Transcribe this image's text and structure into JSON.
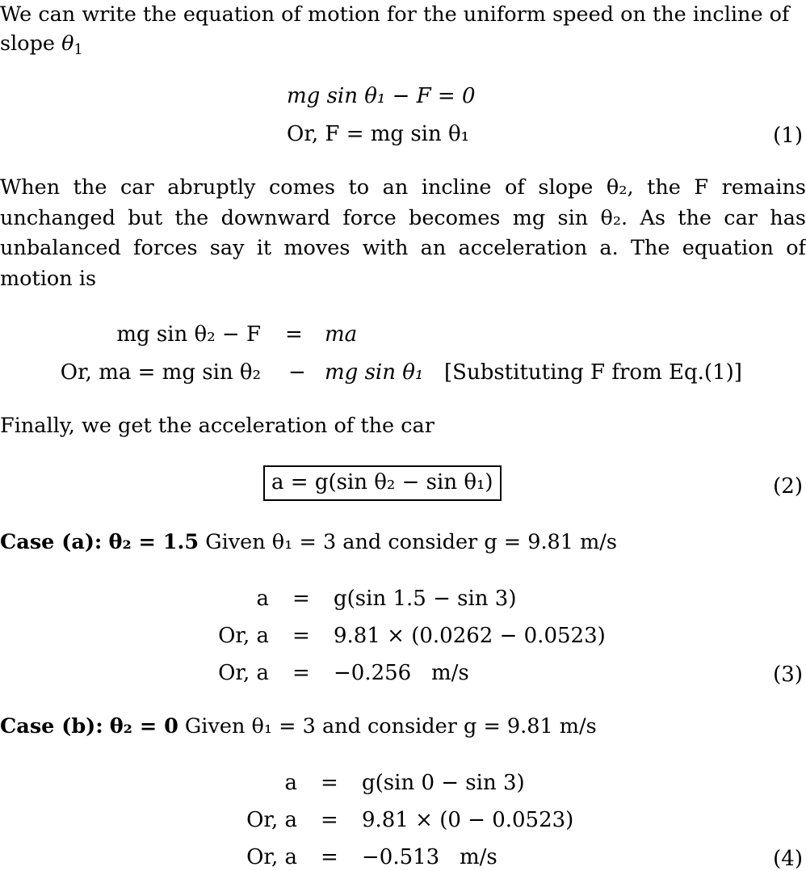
{
  "intro": {
    "line1": "We can write the equation of motion for the uniform speed on the incline of",
    "line2_text": "slope ",
    "line2_var": "θ",
    "line2_sub": "1"
  },
  "eq1": {
    "row1": "mg sin θ₁ − F = 0",
    "row2": "Or, F = mg sin θ₁",
    "number": "(1)"
  },
  "para2": {
    "text": "When the car abruptly comes to an incline of slope θ₂, the F remains unchanged but the downward force becomes mg sin θ₂. As the car has unbalanced forces say it moves with an acceleration a. The equation of motion is"
  },
  "eq_motion": {
    "row1_lhs": "mg sin θ₂ − F",
    "row1_rel": "=",
    "row1_rhs": "ma",
    "row2_lhs": "Or, ma = mg sin θ₂",
    "row2_rel": "−",
    "row2_rhs": "mg sin θ₁",
    "row2_note": "[Substituting F from Eq.(1)]"
  },
  "para3": {
    "text": "Finally, we get the acceleration of the car"
  },
  "eq2": {
    "content": "a = g(sin θ₂ − sin θ₁)",
    "number": "(2)"
  },
  "case_a": {
    "label": "Case (a):",
    "condition": "θ₂ = 1.5",
    "given": "Given θ₁ = 3 and consider g = 9.81 m/s",
    "rows": [
      {
        "lhs": "a",
        "rel": "=",
        "rhs": "g(sin 1.5 − sin 3)"
      },
      {
        "lhs": "Or, a",
        "rel": "=",
        "rhs": "9.81 × (0.0262 − 0.0523)"
      },
      {
        "lhs": "Or, a",
        "rel": "=",
        "rhs": "−0.256   m/s"
      }
    ],
    "number": "(3)"
  },
  "case_b": {
    "label": "Case (b):",
    "condition": "θ₂ = 0",
    "given": "Given θ₁ = 3 and consider g = 9.81 m/s",
    "rows": [
      {
        "lhs": "a",
        "rel": "=",
        "rhs": "g(sin 0 − sin 3)"
      },
      {
        "lhs": "Or, a",
        "rel": "=",
        "rhs": "9.81 × (0 − 0.0523)"
      },
      {
        "lhs": "Or, a",
        "rel": "=",
        "rhs": "−0.513   m/s"
      }
    ],
    "number": "(4)"
  }
}
